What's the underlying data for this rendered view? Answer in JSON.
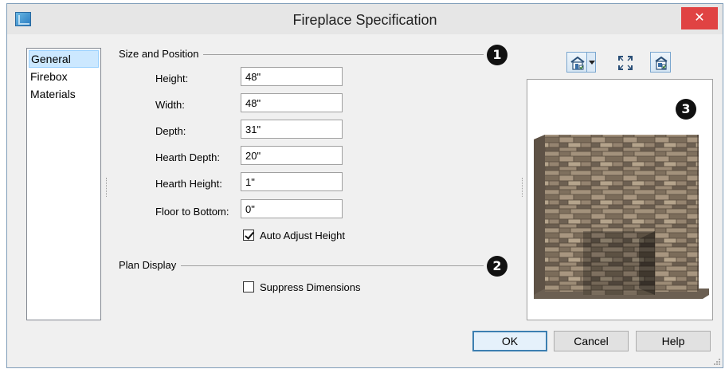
{
  "window": {
    "title": "Fireplace Specification",
    "close_glyph": "✕"
  },
  "nav": {
    "items": [
      "General",
      "Firebox",
      "Materials"
    ],
    "selected": "General"
  },
  "size_position": {
    "heading": "Size and Position",
    "callout": "1",
    "fields": [
      {
        "label": "Height:",
        "value": "48\""
      },
      {
        "label": "Width:",
        "value": "48\""
      },
      {
        "label": "Depth:",
        "value": "31\""
      },
      {
        "label": "Hearth Depth:",
        "value": "20\""
      },
      {
        "label": "Hearth Height:",
        "value": "1\""
      },
      {
        "label": "Floor to Bottom:",
        "value": "0\""
      }
    ],
    "auto_adjust": {
      "label": "Auto Adjust Height",
      "checked": true
    }
  },
  "plan_display": {
    "heading": "Plan Display",
    "callout": "2",
    "suppress": {
      "label": "Suppress Dimensions",
      "checked": false
    }
  },
  "preview": {
    "callout": "3",
    "toolbar_icons": [
      "view-mode-icon",
      "fit-view-icon",
      "camera-view-icon"
    ]
  },
  "buttons": {
    "ok": "OK",
    "cancel": "Cancel",
    "help": "Help"
  },
  "colors": {
    "close": "#e04343",
    "selection": "#cce8ff",
    "dialog_bg": "#f0f0f0",
    "stone": "#8a7a68"
  }
}
